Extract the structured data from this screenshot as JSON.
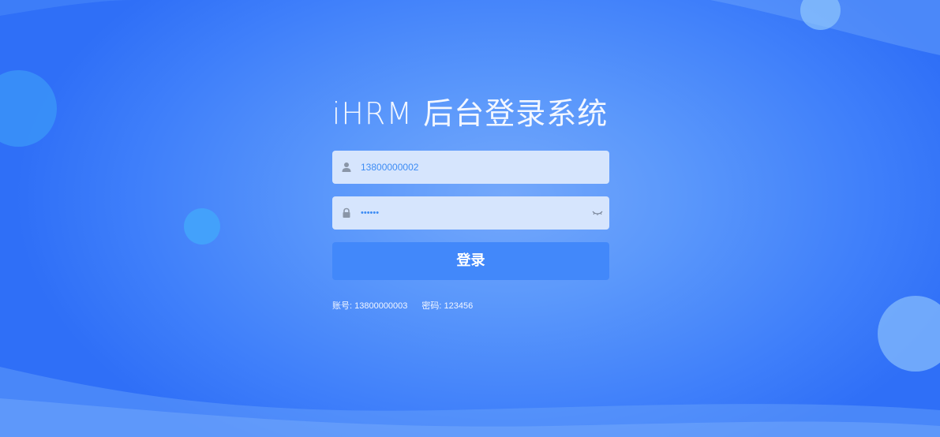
{
  "title": "iHRM 后台登录系统",
  "form": {
    "username_value": "13800000002",
    "password_value": "••••••",
    "submit_label": "登录"
  },
  "hint": {
    "account": "账号: 13800000003",
    "password": "密码: 123456"
  },
  "icons": {
    "username": "user-icon",
    "password": "lock-icon",
    "toggle": "eye-closed-icon"
  },
  "colors": {
    "accent": "#4288fa",
    "input_bg": "#d6e5fd",
    "input_text": "#3d8cf4"
  }
}
